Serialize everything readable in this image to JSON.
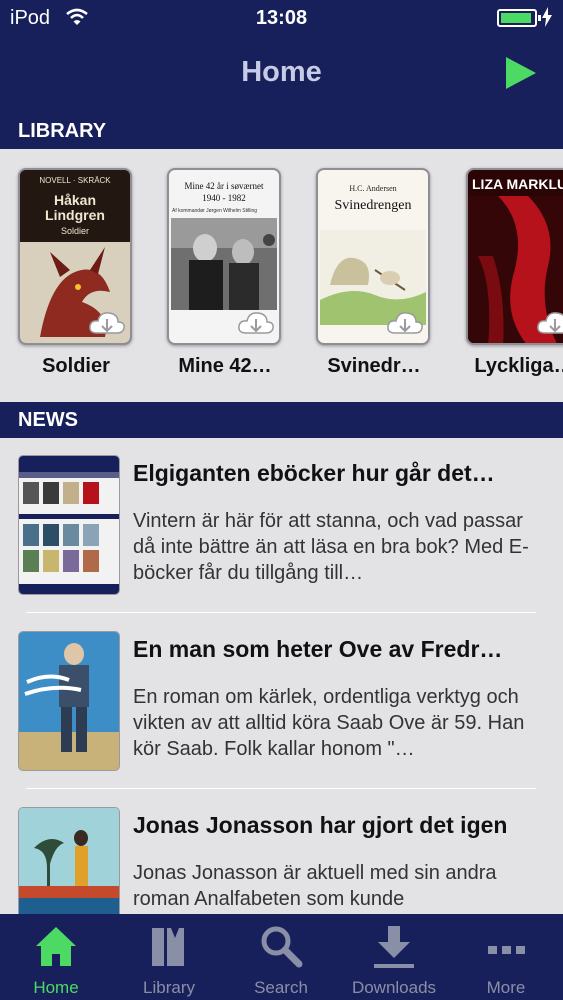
{
  "status_bar": {
    "carrier": "iPod",
    "time": "13:08"
  },
  "nav": {
    "title": "Home"
  },
  "sections": {
    "library": "LIBRARY",
    "news": "NEWS"
  },
  "library": {
    "books": [
      {
        "title": "Soldier",
        "cover_text": {
          "genre": "NOVELL · SKRÄCK",
          "author": "Håkan\nLindgren",
          "subtitle": "Soldier"
        }
      },
      {
        "title": "Mine 42…",
        "cover_text": {
          "top": "Mine 42 år i søværnet\n1940 - 1982",
          "sub": "Af kommandør Jørgen Wilhelm Stilling"
        }
      },
      {
        "title": "Svinedr…",
        "cover_text": {
          "author": "H.C. Andersen",
          "book": "Svinedrengen"
        }
      },
      {
        "title": "Lyckliga…",
        "cover_text": {
          "author": "LIZA MARKLUN"
        }
      }
    ]
  },
  "news": {
    "items": [
      {
        "title": "Elgiganten eböcker hur går det…",
        "body": "Vintern är här för att stanna, och vad passar då inte bättre än att läsa en bra bok? Med E-böcker får du tillgång till…"
      },
      {
        "title": "En man som heter Ove av Fredr…",
        "body": "En roman om kärlek, ordentliga verktyg och vikten av att alltid köra Saab Ove är 59. Han kör Saab. Folk kallar honom \"…"
      },
      {
        "title": "Jonas Jonasson har gjort det igen",
        "body": "Jonas Jonasson är aktuell med sin andra roman Analfabeten som kunde"
      }
    ]
  },
  "tabs": [
    {
      "label": "Home",
      "icon": "home-icon",
      "active": true
    },
    {
      "label": "Library",
      "icon": "library-icon",
      "active": false
    },
    {
      "label": "Search",
      "icon": "search-icon",
      "active": false
    },
    {
      "label": "Downloads",
      "icon": "downloads-icon",
      "active": false
    },
    {
      "label": "More",
      "icon": "more-icon",
      "active": false
    }
  ],
  "colors": {
    "bar": "#17205a",
    "accent_green": "#4cd964",
    "inactive_tab": "#8a8fa8",
    "background": "#e3e3e6"
  }
}
